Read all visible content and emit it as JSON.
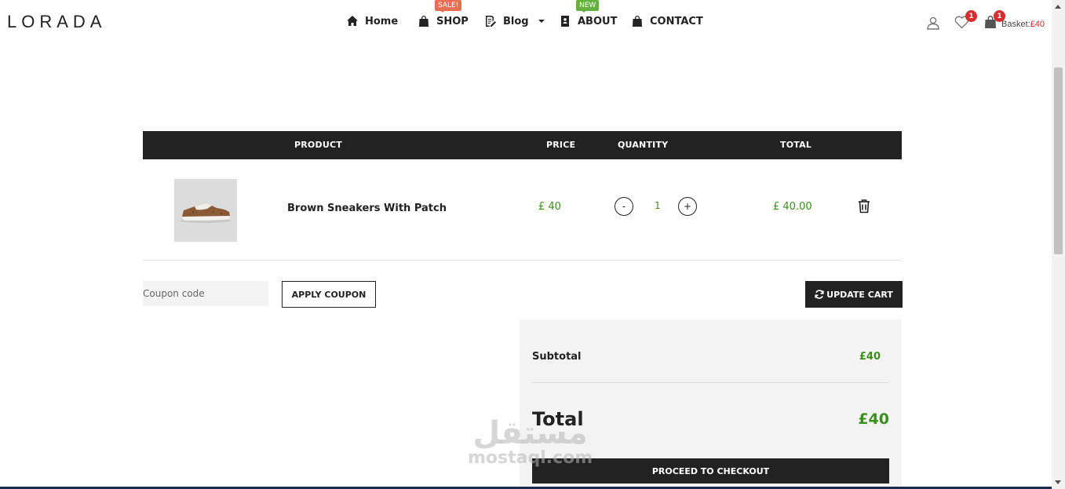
{
  "brand": {
    "logo": "LORADA"
  },
  "nav": {
    "home": "Home",
    "shop": "SHOP",
    "shop_badge": "SALE!",
    "blog": "Blog",
    "about": "ABOUT",
    "about_badge": "NEW",
    "contact": "CONTACT"
  },
  "header": {
    "wishlist_count": "1",
    "basket_count": "1",
    "basket_label": "Basket:",
    "basket_amount": "£40"
  },
  "cart": {
    "columns": {
      "product": "PRODUCT",
      "price": "PRICE",
      "quantity": "QUANTITY",
      "total": "TOTAL"
    },
    "items": [
      {
        "name": "Brown Sneakers With Patch",
        "price": "£ 40",
        "quantity": "1",
        "total": "£ 40.00",
        "image": "brown-sneaker"
      }
    ],
    "qty_minus": "-",
    "qty_plus": "+"
  },
  "coupon": {
    "placeholder": "Coupon code",
    "apply_label": "APPLY COUPON"
  },
  "update_label": "UPDATE CART",
  "totals": {
    "subtotal_label": "Subtotal",
    "subtotal_value": "£40",
    "total_label": "Total",
    "total_value": "£40",
    "checkout_label": "PROCEED TO CHECKOUT"
  },
  "watermark": {
    "arabic": "مستقل",
    "latin": "mostaql.com"
  },
  "colors": {
    "accent_green": "#3c8f1e",
    "dark": "#222222",
    "badge_red": "#d32f2f",
    "sale": "#e86f52",
    "new": "#64b140"
  }
}
